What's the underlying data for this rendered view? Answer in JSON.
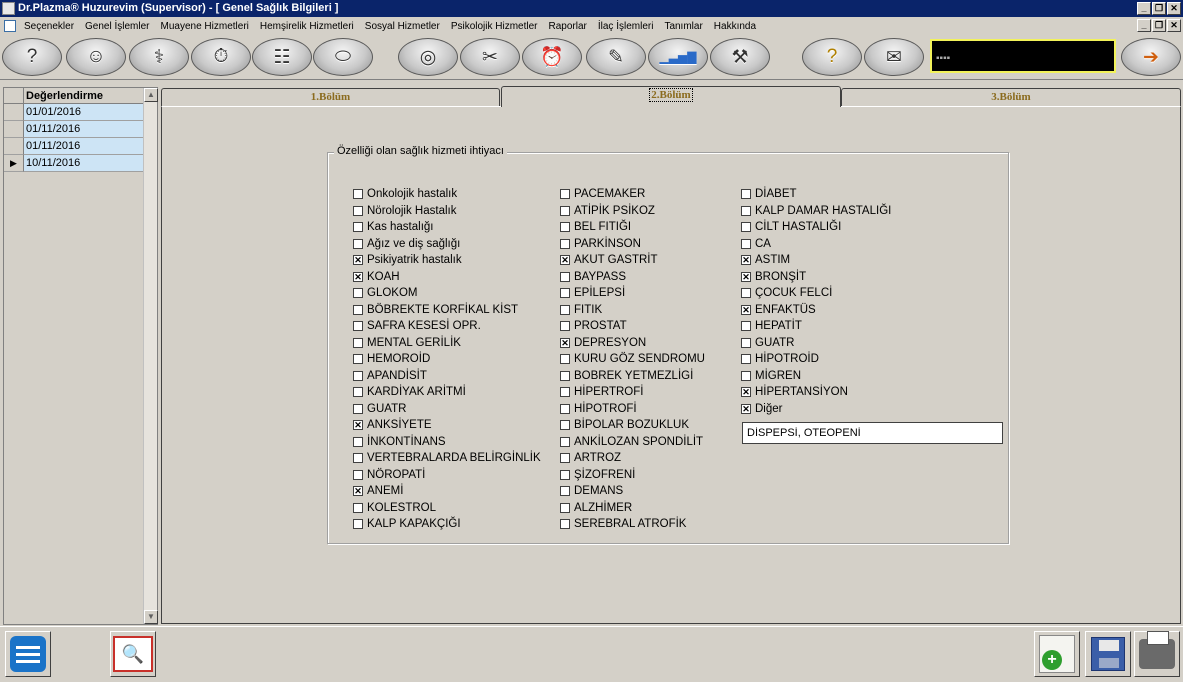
{
  "window": {
    "title": "Dr.Plazma® Huzurevim (Supervisor) - [ Genel Sağlık Bilgileri ]"
  },
  "menu": {
    "items": [
      "Seçenekler",
      "Genel İşlemler",
      "Muayene Hizmetleri",
      "Hemşirelik Hizmetleri",
      "Sosyal Hizmetler",
      "Psikolojik Hizmetler",
      "Raporlar",
      "İlaç İşlemleri",
      "Tanımlar",
      "Hakkında"
    ]
  },
  "toolbar": {
    "buttons": [
      {
        "icon": "help-head-icon",
        "glyph": "?"
      },
      {
        "icon": "doctors-icon",
        "glyph": "☺"
      },
      {
        "icon": "nurse-icon",
        "glyph": "⚕"
      },
      {
        "icon": "stopwatch-icon",
        "glyph": "⏱"
      },
      {
        "icon": "doc-report-icon",
        "glyph": "☷"
      },
      {
        "icon": "pills-icon",
        "glyph": "⬭"
      },
      {
        "icon": "spiral-icon",
        "glyph": "◎"
      },
      {
        "icon": "bandage-icon",
        "glyph": "✂"
      },
      {
        "icon": "calendar-clock-icon",
        "glyph": "⏰"
      },
      {
        "icon": "clipboard-icon",
        "glyph": "✎"
      },
      {
        "icon": "bar-chart-icon",
        "glyph": "▁▃▅▇"
      },
      {
        "icon": "tools-icon",
        "glyph": "⚒"
      },
      {
        "icon": "help-note-icon",
        "glyph": "?"
      },
      {
        "icon": "mail-icon",
        "glyph": "✉"
      },
      {
        "icon": "globe-exit-icon",
        "glyph": "➔"
      }
    ],
    "info_text": "▪▪▪▪"
  },
  "grid": {
    "column_header": "Değerlendirme",
    "rows": [
      {
        "date": "01/01/2016",
        "current": false
      },
      {
        "date": "01/11/2016",
        "current": false
      },
      {
        "date": "01/11/2016",
        "current": false
      },
      {
        "date": "10/11/2016",
        "current": true
      }
    ],
    "current_marker": "▶"
  },
  "tabs": [
    {
      "label": "1.Bölüm",
      "active": false
    },
    {
      "label": "2.Bölüm",
      "active": true
    },
    {
      "label": "3.Bölüm",
      "active": false
    }
  ],
  "group": {
    "title": "Özelliği olan sağlık hizmeti ihtiyacı",
    "columns": [
      [
        {
          "label": "Onkolojik hastalık",
          "checked": false
        },
        {
          "label": "Nörolojik Hastalık",
          "checked": false
        },
        {
          "label": "Kas hastalığı",
          "checked": false
        },
        {
          "label": "Ağız ve diş sağlığı",
          "checked": false
        },
        {
          "label": "Psikiyatrik hastalık",
          "checked": true
        },
        {
          "label": "KOAH",
          "checked": true
        },
        {
          "label": "GLOKOM",
          "checked": false
        },
        {
          "label": "BÖBREKTE KORFİKAL KİST",
          "checked": false
        },
        {
          "label": "SAFRA KESESİ OPR.",
          "checked": false
        },
        {
          "label": "MENTAL GERİLİK",
          "checked": false
        },
        {
          "label": "HEMOROİD",
          "checked": false
        },
        {
          "label": "APANDİSİT",
          "checked": false
        },
        {
          "label": "KARDİYAK ARİTMİ",
          "checked": false
        },
        {
          "label": "GUATR",
          "checked": false
        },
        {
          "label": "ANKSİYETE",
          "checked": true
        },
        {
          "label": "İNKONTİNANS",
          "checked": false
        },
        {
          "label": "VERTEBRALARDA BELİRGİNLİK",
          "checked": false
        },
        {
          "label": "NÖROPATİ",
          "checked": false
        },
        {
          "label": "ANEMİ",
          "checked": true
        },
        {
          "label": "KOLESTROL",
          "checked": false
        },
        {
          "label": "KALP KAPAKÇIĞI",
          "checked": false
        }
      ],
      [
        {
          "label": "PACEMAKER",
          "checked": false
        },
        {
          "label": "ATİPİK PSİKOZ",
          "checked": false
        },
        {
          "label": "BEL FITIĞI",
          "checked": false
        },
        {
          "label": "PARKİNSON",
          "checked": false
        },
        {
          "label": "AKUT GASTRİT",
          "checked": true
        },
        {
          "label": "BAYPASS",
          "checked": false
        },
        {
          "label": "EPİLEPSİ",
          "checked": false
        },
        {
          "label": "FITIK",
          "checked": false
        },
        {
          "label": "PROSTAT",
          "checked": false
        },
        {
          "label": "DEPRESYON",
          "checked": true
        },
        {
          "label": "KURU GÖZ SENDROMU",
          "checked": false
        },
        {
          "label": "BOBREK YETMEZLİGİ",
          "checked": false
        },
        {
          "label": "HİPERTROFİ",
          "checked": false
        },
        {
          "label": "HİPOTROFİ",
          "checked": false
        },
        {
          "label": "BİPOLAR BOZUKLUK",
          "checked": false
        },
        {
          "label": "ANKİLOZAN SPONDİLİT",
          "checked": false
        },
        {
          "label": "ARTROZ",
          "checked": false
        },
        {
          "label": "ŞİZOFRENİ",
          "checked": false
        },
        {
          "label": "DEMANS",
          "checked": false
        },
        {
          "label": "ALZHİMER",
          "checked": false
        },
        {
          "label": "SEREBRAL ATROFİK",
          "checked": false
        }
      ],
      [
        {
          "label": "DİABET",
          "checked": false
        },
        {
          "label": "KALP DAMAR HASTALIĞI",
          "checked": false
        },
        {
          "label": "CİLT HASTALIĞI",
          "checked": false
        },
        {
          "label": "CA",
          "checked": false
        },
        {
          "label": "ASTIM",
          "checked": true
        },
        {
          "label": "BRONŞİT",
          "checked": true
        },
        {
          "label": "ÇOCUK FELCİ",
          "checked": false
        },
        {
          "label": "ENFAKTÜS",
          "checked": true
        },
        {
          "label": "HEPATİT",
          "checked": false
        },
        {
          "label": "GUATR",
          "checked": false
        },
        {
          "label": "HİPOTROİD",
          "checked": false
        },
        {
          "label": "MİGREN",
          "checked": false
        },
        {
          "label": "HİPERTANSİYON",
          "checked": true
        },
        {
          "label": "Diğer",
          "checked": true
        }
      ]
    ],
    "other_value": "DİSPEPSİ, OTEOPENİ"
  },
  "bottom": {
    "buttons": [
      "list-icon",
      "report-preview-icon",
      "add-document-icon",
      "save-icon",
      "print-icon"
    ]
  }
}
